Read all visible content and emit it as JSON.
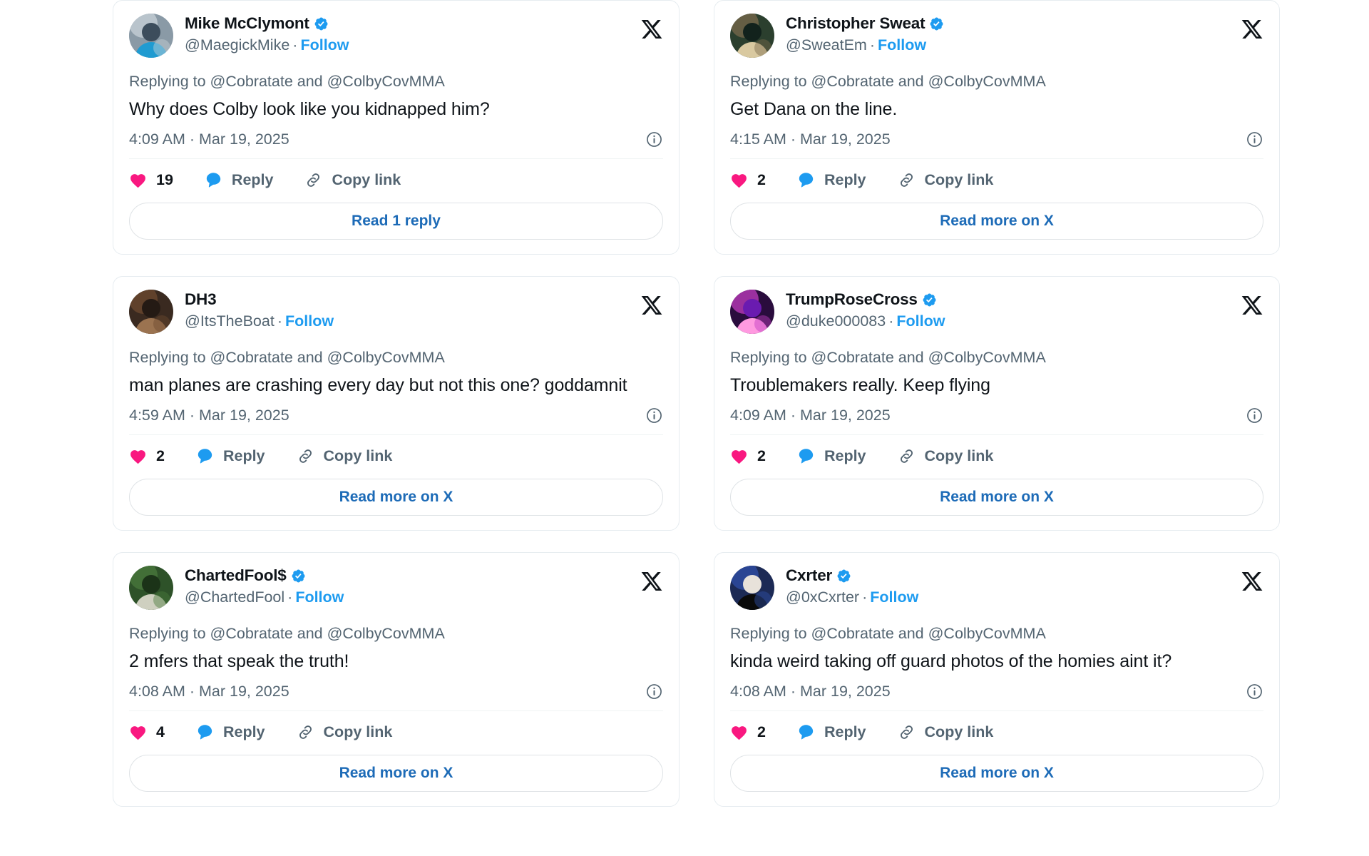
{
  "theme": {
    "accent_blue": "#1d9bf0",
    "link_blue": "#1d6bb7",
    "heart_pink": "#f91880",
    "reply_blue": "#1d9bf0",
    "text_primary": "#0f1419",
    "text_secondary": "#536471",
    "card_border": "#e6ecf0",
    "page_background": "#ffffff"
  },
  "icons": {
    "x_logo": "x-logo-icon",
    "verified": "verified-badge-icon",
    "info": "info-circle-icon",
    "heart": "heart-icon",
    "reply": "reply-bubble-icon",
    "copy_link": "link-chain-icon"
  },
  "columns": [
    {
      "name": "left-column",
      "cards": [
        {
          "display_name": "Mike McClymont",
          "verified": true,
          "handle": "@MaegickMike",
          "separator": "·",
          "follow_label": "Follow",
          "replying_to": "Replying to @Cobratate and @ColbyCovMMA",
          "text": "Why does Colby look like you kidnapped him?",
          "timestamp": "4:09 AM · Mar 19, 2025",
          "like_count": "19",
          "reply_label": "Reply",
          "copy_link_label": "Copy link",
          "read_button_label": "Read 1 reply",
          "avatar_colors": [
            "#8a9aa6",
            "#c8d2d8",
            "#3c4d5c",
            "#1f9bd1"
          ]
        },
        {
          "display_name": "DH3",
          "verified": false,
          "handle": "@ItsTheBoat",
          "separator": "·",
          "follow_label": "Follow",
          "replying_to": "Replying to @Cobratate and @ColbyCovMMA",
          "text": "man planes are crashing every day but not this one? goddamnit",
          "timestamp": "4:59 AM · Mar 19, 2025",
          "like_count": "2",
          "reply_label": "Reply",
          "copy_link_label": "Copy link",
          "read_button_label": "Read more on X",
          "avatar_colors": [
            "#3a2a20",
            "#6d4a2f",
            "#241a14",
            "#9b7350"
          ]
        },
        {
          "display_name": "ChartedFool$",
          "verified": true,
          "handle": "@ChartedFool",
          "separator": "·",
          "follow_label": "Follow",
          "replying_to": "Replying to @Cobratate and @ColbyCovMMA",
          "text": "2 mfers that speak the truth!",
          "timestamp": "4:08 AM · Mar 19, 2025",
          "like_count": "4",
          "reply_label": "Reply",
          "copy_link_label": "Copy link",
          "read_button_label": "Read more on X",
          "avatar_colors": [
            "#2e5229",
            "#4a7a3c",
            "#1b3318",
            "#cfd0c0"
          ]
        }
      ]
    },
    {
      "name": "right-column",
      "cards": [
        {
          "display_name": "Christopher Sweat",
          "verified": true,
          "handle": "@SweatEm",
          "separator": "·",
          "follow_label": "Follow",
          "replying_to": "Replying to @Cobratate and @ColbyCovMMA",
          "text": "Get Dana on the line.",
          "timestamp": "4:15 AM · Mar 19, 2025",
          "like_count": "2",
          "reply_label": "Reply",
          "copy_link_label": "Copy link",
          "read_button_label": "Read more on X",
          "avatar_colors": [
            "#2b3f2e",
            "#7a6a4c",
            "#12221c",
            "#d9c9a0"
          ]
        },
        {
          "display_name": "TrumpRoseCross",
          "verified": true,
          "handle": "@duke000083",
          "separator": "·",
          "follow_label": "Follow",
          "replying_to": "Replying to @Cobratate and @ColbyCovMMA",
          "text": "Troublemakers really. Keep flying",
          "timestamp": "4:09 AM · Mar 19, 2025",
          "like_count": "2",
          "reply_label": "Reply",
          "copy_link_label": "Copy link",
          "read_button_label": "Read more on X",
          "avatar_colors": [
            "#2a0c3d",
            "#c23cc0",
            "#6a1bb0",
            "#ff9ae0"
          ]
        },
        {
          "display_name": "Cxrter",
          "verified": true,
          "handle": "@0xCxrter",
          "separator": "·",
          "follow_label": "Follow",
          "replying_to": "Replying to @Cobratate and @ColbyCovMMA",
          "text": "kinda weird taking off guard photos of the homies aint it?",
          "timestamp": "4:08 AM · Mar 19, 2025",
          "like_count": "2",
          "reply_label": "Reply",
          "copy_link_label": "Copy link",
          "read_button_label": "Read more on X",
          "avatar_colors": [
            "#1c2a55",
            "#2f4fa8",
            "#e8e2da",
            "#0a0a0a"
          ]
        }
      ]
    }
  ]
}
